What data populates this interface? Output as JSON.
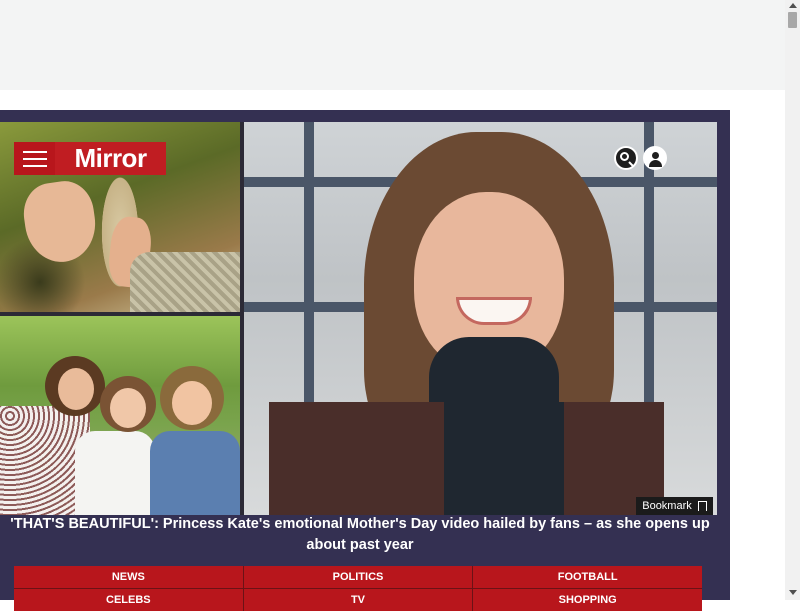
{
  "brand": {
    "logo_text": "Mirror",
    "accent_color": "#c01d22",
    "card_background": "#343052"
  },
  "header": {
    "menu_icon": "hamburger-menu-icon",
    "search_icon": "search-icon",
    "account_icon": "account-icon"
  },
  "article": {
    "bookmark_label": "Bookmark",
    "headline": "'THAT'S BEAUTIFUL': Princess Kate's emotional Mother's Day video hailed by fans – as she opens up about past year"
  },
  "nav": {
    "items": [
      "NEWS",
      "POLITICS",
      "FOOTBALL",
      "CELEBS",
      "TV",
      "SHOPPING"
    ]
  }
}
